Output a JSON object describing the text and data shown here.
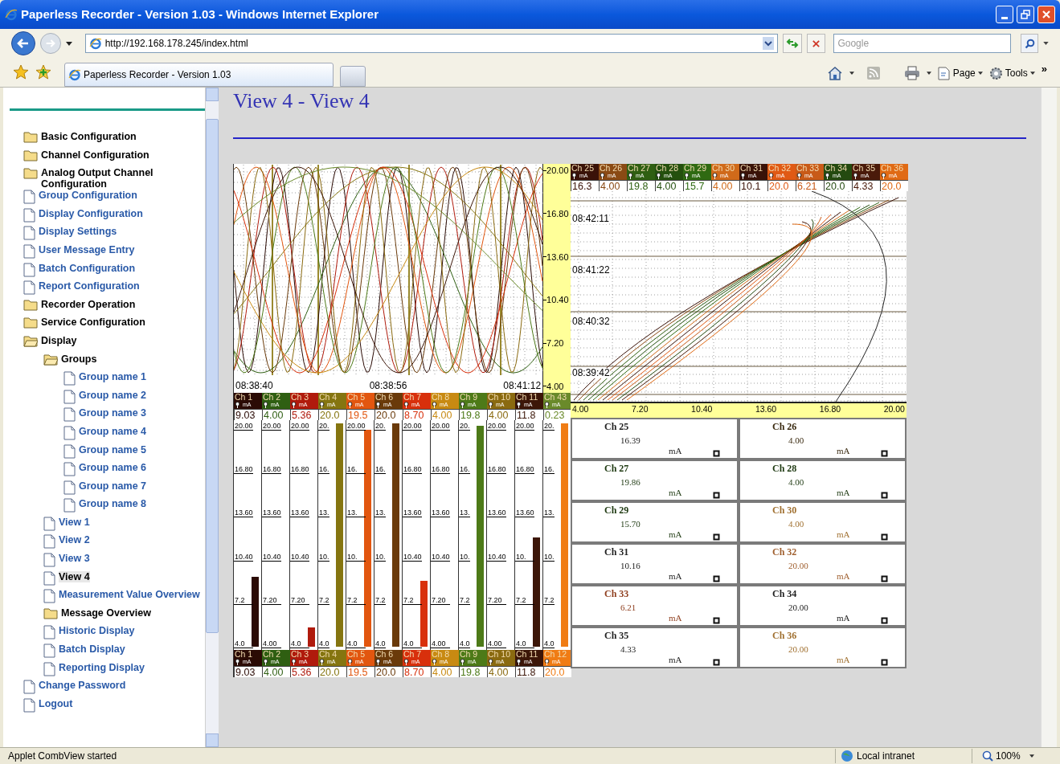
{
  "window": {
    "title": "Paperless Recorder - Version 1.03 - Windows Internet Explorer"
  },
  "address_bar": {
    "value": "http://192.168.178.245/index.html"
  },
  "search": {
    "placeholder": "Google"
  },
  "tabs": [
    {
      "label": "Paperless Recorder - Version 1.03",
      "selected": true
    }
  ],
  "toolbar": {
    "page": "Page",
    "tools": "Tools",
    "more": "»"
  },
  "sidebar": {
    "items": [
      {
        "label": "Basic Configuration",
        "kind": "folder",
        "expanded": false,
        "selected": false
      },
      {
        "label": "Channel Configuration",
        "kind": "folder",
        "expanded": false,
        "selected": false
      },
      {
        "label": "Analog Output Channel Configuration",
        "kind": "folder",
        "expanded": false,
        "selected": false
      },
      {
        "label": "Group Configuration",
        "kind": "page",
        "selected": false
      },
      {
        "label": "Display Configuration",
        "kind": "page",
        "selected": false
      },
      {
        "label": "Display Settings",
        "kind": "page",
        "selected": false
      },
      {
        "label": "User Message Entry",
        "kind": "page",
        "selected": false
      },
      {
        "label": "Batch Configuration",
        "kind": "page",
        "selected": false
      },
      {
        "label": "Report Configuration",
        "kind": "page",
        "selected": false
      },
      {
        "label": "Recorder Operation",
        "kind": "folder",
        "expanded": false,
        "selected": false
      },
      {
        "label": "Service Configuration",
        "kind": "folder",
        "expanded": false,
        "selected": false
      },
      {
        "label": "Display",
        "kind": "folder",
        "expanded": true,
        "selected": false,
        "children": [
          {
            "label": "Groups",
            "kind": "folder",
            "expanded": true,
            "selected": false,
            "children": [
              {
                "label": "Group name 1",
                "kind": "page",
                "selected": false
              },
              {
                "label": "Group name 2",
                "kind": "page",
                "selected": false
              },
              {
                "label": "Group name 3",
                "kind": "page",
                "selected": false
              },
              {
                "label": "Group name 4",
                "kind": "page",
                "selected": false
              },
              {
                "label": "Group name 5",
                "kind": "page",
                "selected": false
              },
              {
                "label": "Group name 6",
                "kind": "page",
                "selected": false
              },
              {
                "label": "Group name 7",
                "kind": "page",
                "selected": false
              },
              {
                "label": "Group name 8",
                "kind": "page",
                "selected": false
              }
            ]
          },
          {
            "label": "View 1",
            "kind": "page",
            "selected": false
          },
          {
            "label": "View 2",
            "kind": "page",
            "selected": false
          },
          {
            "label": "View 3",
            "kind": "page",
            "selected": false
          },
          {
            "label": "View 4",
            "kind": "page",
            "selected": true
          },
          {
            "label": "Measurement Value Overview",
            "kind": "page",
            "selected": false
          },
          {
            "label": "Message Overview",
            "kind": "folder",
            "expanded": false,
            "selected": false
          },
          {
            "label": "Historic Display",
            "kind": "page",
            "selected": false
          },
          {
            "label": "Batch Display",
            "kind": "page",
            "selected": false
          },
          {
            "label": "Reporting Display",
            "kind": "page",
            "selected": false
          }
        ]
      },
      {
        "label": "Change Password",
        "kind": "page",
        "selected": false
      },
      {
        "label": "Logout",
        "kind": "page",
        "selected": false
      }
    ]
  },
  "page_title": "View 4 - View 4",
  "vertical_trend": {
    "scale": [
      "20.00",
      "16.80",
      "13.60",
      "10.40",
      "7.20",
      "4.00"
    ],
    "timestamps": [
      "08:38:40",
      "08:38:56",
      "08:41:12"
    ],
    "channels": [
      {
        "name": "Ch 1",
        "unit": "mA",
        "value": "9.03",
        "color": "#2b0b05"
      },
      {
        "name": "Ch 2",
        "unit": "mA",
        "value": "4.00",
        "color": "#2f5f12"
      },
      {
        "name": "Ch 3",
        "unit": "mA",
        "value": "5.36",
        "color": "#b01a0c"
      },
      {
        "name": "Ch 4",
        "unit": "mA",
        "value": "20.0",
        "color": "#857510"
      },
      {
        "name": "Ch 5",
        "unit": "mA",
        "value": "19.5",
        "color": "#e2560f"
      },
      {
        "name": "Ch 6",
        "unit": "mA",
        "value": "20.0",
        "color": "#6a3a0a"
      },
      {
        "name": "Ch 7",
        "unit": "mA",
        "value": "8.70",
        "color": "#d8300c"
      },
      {
        "name": "Ch 8",
        "unit": "mA",
        "value": "4.00",
        "color": "#c88a12"
      },
      {
        "name": "Ch 9",
        "unit": "mA",
        "value": "19.8",
        "color": "#4d7a18"
      },
      {
        "name": "Ch 10",
        "unit": "mA",
        "value": "4.00",
        "color": "#8a6a10"
      },
      {
        "name": "Ch 11",
        "unit": "mA",
        "value": "11.8",
        "color": "#3c1608"
      },
      {
        "name": "Ch 43",
        "unit": "mA",
        "value": "0.23",
        "color": "#6a8a2a"
      }
    ]
  },
  "bars": [
    {
      "name": "Ch 1",
      "unit": "mA",
      "value": "9.03",
      "color": "#2b0b05",
      "level": 0.314,
      "scale": [
        "20.00",
        "16.80",
        "13.60",
        "10.40",
        "7.2",
        "4.0"
      ]
    },
    {
      "name": "Ch 2",
      "unit": "mA",
      "value": "4.00",
      "color": "#2f5f12",
      "level": 0,
      "scale": [
        "20.00",
        "16.80",
        "13.60",
        "10.40",
        "7.20",
        "4.00"
      ]
    },
    {
      "name": "Ch 3",
      "unit": "mA",
      "value": "5.36",
      "color": "#b01a0c",
      "level": 0.085,
      "scale": [
        "20.00",
        "16.80",
        "13.60",
        "10.40",
        "7.20",
        "4.0"
      ]
    },
    {
      "name": "Ch 4",
      "unit": "mA",
      "value": "20.0",
      "color": "#857510",
      "level": 1,
      "scale": [
        "20.",
        "16.",
        "13.",
        "10.",
        "7.2",
        "4.0"
      ]
    },
    {
      "name": "Ch 5",
      "unit": "mA",
      "value": "19.5",
      "color": "#e2560f",
      "level": 0.97,
      "scale": [
        "20.00",
        "16.",
        "13.",
        "10.",
        "7.2",
        "4.0"
      ]
    },
    {
      "name": "Ch 6",
      "unit": "mA",
      "value": "20.0",
      "color": "#6a3a0a",
      "level": 1,
      "scale": [
        "20.",
        "16.",
        "13.",
        "10.",
        "7.2",
        "4.0"
      ]
    },
    {
      "name": "Ch 7",
      "unit": "mA",
      "value": "8.70",
      "color": "#d8300c",
      "level": 0.294,
      "scale": [
        "20.00",
        "16.80",
        "13.60",
        "10.40",
        "7.2",
        "4.0"
      ]
    },
    {
      "name": "Ch 8",
      "unit": "mA",
      "value": "4.00",
      "color": "#c88a12",
      "level": 0,
      "scale": [
        "20.00",
        "16.80",
        "13.60",
        "10.40",
        "7.20",
        "4.00"
      ]
    },
    {
      "name": "Ch 9",
      "unit": "mA",
      "value": "19.8",
      "color": "#4d7a18",
      "level": 0.99,
      "scale": [
        "20.",
        "16.",
        "13.",
        "10.",
        "7.2",
        "4.0"
      ]
    },
    {
      "name": "Ch 10",
      "unit": "mA",
      "value": "4.00",
      "color": "#8a6a10",
      "level": 0,
      "scale": [
        "20.00",
        "16.80",
        "13.60",
        "10.40",
        "7.20",
        "4.00"
      ]
    },
    {
      "name": "Ch 11",
      "unit": "mA",
      "value": "11.8",
      "color": "#3c1608",
      "level": 0.49,
      "scale": [
        "20.00",
        "16.80",
        "13.60",
        "10.",
        "7.2",
        "4.0"
      ]
    },
    {
      "name": "Ch 12",
      "unit": "mA",
      "value": "20.0",
      "color": "#f07c14",
      "level": 1,
      "scale": [
        "20.",
        "16.",
        "13.",
        "10.",
        "7.2",
        "4.0"
      ]
    }
  ],
  "horizontal_trend": {
    "axis": [
      "4.00",
      "7.20",
      "10.40",
      "13.60",
      "16.80",
      "20.00"
    ],
    "timestamps": [
      "08:42:11",
      "08:41:22",
      "08:40:32",
      "08:39:42"
    ],
    "channels": [
      {
        "name": "Ch 25",
        "unit": "mA",
        "value": "16.3",
        "color": "#3a1208"
      },
      {
        "name": "Ch 26",
        "unit": "mA",
        "value": "4.00",
        "color": "#8a4a14"
      },
      {
        "name": "Ch 27",
        "unit": "mA",
        "value": "19.8",
        "color": "#2f5f12"
      },
      {
        "name": "Ch 28",
        "unit": "mA",
        "value": "4.00",
        "color": "#24500e"
      },
      {
        "name": "Ch 29",
        "unit": "mA",
        "value": "15.7",
        "color": "#2f6a12"
      },
      {
        "name": "Ch 30",
        "unit": "mA",
        "value": "4.00",
        "color": "#d06a1a"
      },
      {
        "name": "Ch 31",
        "unit": "mA",
        "value": "10.1",
        "color": "#3a1208"
      },
      {
        "name": "Ch 32",
        "unit": "mA",
        "value": "20.0",
        "color": "#e05a14"
      },
      {
        "name": "Ch 33",
        "unit": "mA",
        "value": "6.21",
        "color": "#c85a18"
      },
      {
        "name": "Ch 34",
        "unit": "mA",
        "value": "20.0",
        "color": "#244a10"
      },
      {
        "name": "Ch 35",
        "unit": "mA",
        "value": "4.33",
        "color": "#4a1a0a"
      },
      {
        "name": "Ch 36",
        "unit": "mA",
        "value": "20.0",
        "color": "#e06a14"
      }
    ]
  },
  "digital_panels": [
    {
      "name": "Ch 25",
      "value": "16.39",
      "unit": "mA",
      "color": "#222222"
    },
    {
      "name": "Ch 26",
      "value": "4.00",
      "unit": "mA",
      "color": "#3a2a10"
    },
    {
      "name": "Ch 27",
      "value": "19.86",
      "unit": "mA",
      "color": "#1f3a12"
    },
    {
      "name": "Ch 28",
      "value": "4.00",
      "unit": "mA",
      "color": "#1f3a12"
    },
    {
      "name": "Ch 29",
      "value": "15.70",
      "unit": "mA",
      "color": "#1f3a12"
    },
    {
      "name": "Ch 30",
      "value": "4.00",
      "unit": "mA",
      "color": "#a07030"
    },
    {
      "name": "Ch 31",
      "value": "10.16",
      "unit": "mA",
      "color": "#222222"
    },
    {
      "name": "Ch 32",
      "value": "20.00",
      "unit": "mA",
      "color": "#a06030"
    },
    {
      "name": "Ch 33",
      "value": "6.21",
      "unit": "mA",
      "color": "#904020"
    },
    {
      "name": "Ch 34",
      "value": "20.00",
      "unit": "mA",
      "color": "#222222"
    },
    {
      "name": "Ch 35",
      "value": "4.33",
      "unit": "mA",
      "color": "#222222"
    },
    {
      "name": "Ch 36",
      "value": "20.00",
      "unit": "mA",
      "color": "#a07030"
    }
  ],
  "status_bar": {
    "message": "Applet CombView started",
    "zone": "Local intranet",
    "zoom": "100%"
  }
}
